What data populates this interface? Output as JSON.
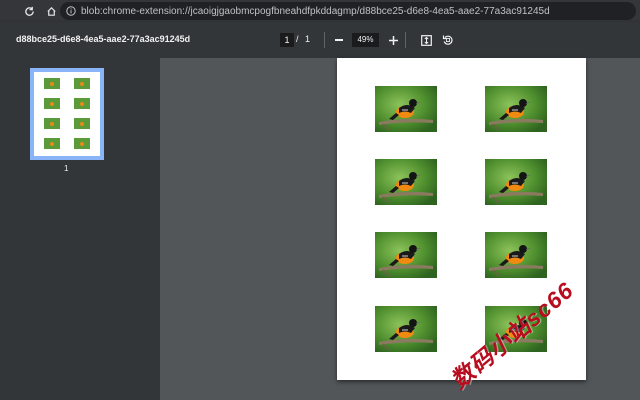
{
  "browser": {
    "url": "blob:chrome-extension://jcaoigjgaobmcpogfbneahdfpkddagmp/d88bce25-d6e8-4ea5-aae2-77a3ac91245d"
  },
  "viewer": {
    "doc_title": "d88bce25-d6e8-4ea5-aae2-77a3ac91245d",
    "current_page": "1",
    "page_separator": "/",
    "total_pages": "1",
    "zoom": "49%"
  },
  "sidebar": {
    "thumbnail_label": "1"
  },
  "page": {
    "image_count": 8
  },
  "watermark": {
    "text": "数码小站sc66"
  },
  "icons": {
    "reload": "reload-icon",
    "home": "home-icon",
    "info": "info-icon",
    "zoom_out": "minus-icon",
    "zoom_in": "plus-icon",
    "fit": "fit-to-page-icon",
    "rotate": "rotate-icon"
  },
  "colors": {
    "toolbar": "#323639",
    "viewer_bg": "#525659",
    "thumb_border": "#8ab4f8",
    "watermark": "#b80d1e"
  }
}
